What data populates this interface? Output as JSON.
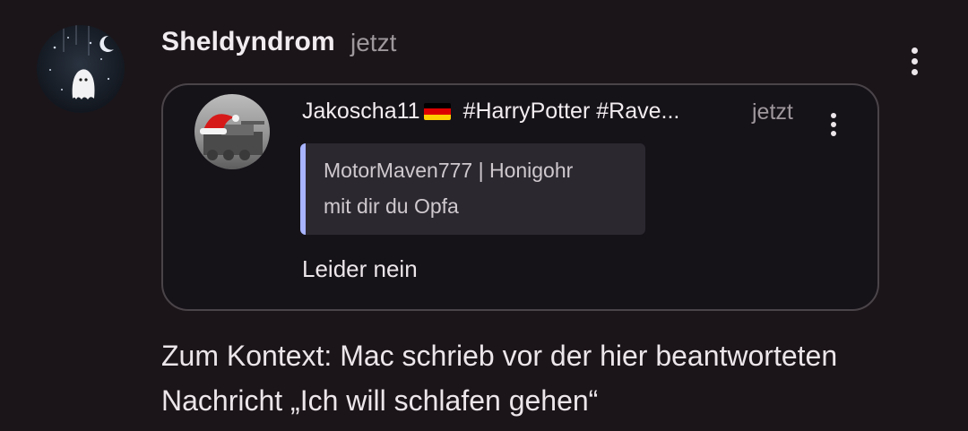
{
  "comment": {
    "author": "Sheldyndrom",
    "time": "jetzt",
    "avatar_icon": "ghost-night-avatar",
    "menu_icon": "kebab-menu-icon",
    "message": "Zum Kontext: Mac schrieb vor der hier beantworteten Nachricht „Ich will schlafen gehen“"
  },
  "quoted": {
    "author": "Jakoscha11",
    "flag_icon": "germany-flag-icon",
    "flag_colors": [
      "#000000",
      "#dd0000",
      "#ffce00"
    ],
    "tags": "#HarryPotter #Rave...",
    "time": "jetzt",
    "avatar_icon": "santa-hat-avatar",
    "menu_icon": "kebab-menu-icon",
    "reply_to": {
      "author": "MotorMaven777 | Honigohr",
      "text": "mit dir du Opfa",
      "accent": "#a8b4ff"
    },
    "message": "Leider nein"
  },
  "colors": {
    "background": "#1b1519",
    "card_border": "#4a4449",
    "muted_text": "#9e979c"
  }
}
